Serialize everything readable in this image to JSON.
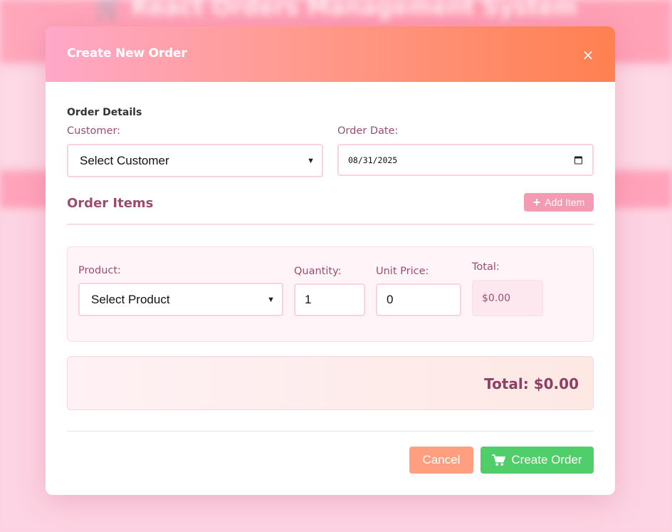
{
  "background": {
    "app_title": "🛒 React Orders Management System"
  },
  "modal": {
    "title": "Create New Order",
    "close_label": "×",
    "order_details": {
      "section_title": "Order Details",
      "customer_label": "Customer:",
      "customer_value": "Select Customer",
      "date_label": "Order Date:",
      "date_value": "08/31/2025"
    },
    "order_items": {
      "title": "Order Items",
      "add_item_label": "Add Item",
      "items": [
        {
          "product_label": "Product:",
          "product_value": "Select Product",
          "quantity_label": "Quantity:",
          "quantity_value": "1",
          "unit_price_label": "Unit Price:",
          "unit_price_value": "0",
          "total_label": "Total:",
          "total_value": "$0.00"
        }
      ]
    },
    "grand_total": "Total: $0.00",
    "footer": {
      "cancel_label": "Cancel",
      "create_label": "Create Order"
    }
  },
  "colors": {
    "header_gradient_start": "#ffa8c8",
    "header_gradient_end": "#ff8050",
    "label_color": "#9a4d70",
    "add_button": "#f59ab3",
    "cancel_button": "#ff9f7f",
    "create_button": "#4fce69"
  },
  "icons": {
    "close": "close-icon",
    "add": "plus-icon",
    "create": "cart-icon",
    "date": "calendar-icon",
    "select": "chevron-down-icon"
  }
}
